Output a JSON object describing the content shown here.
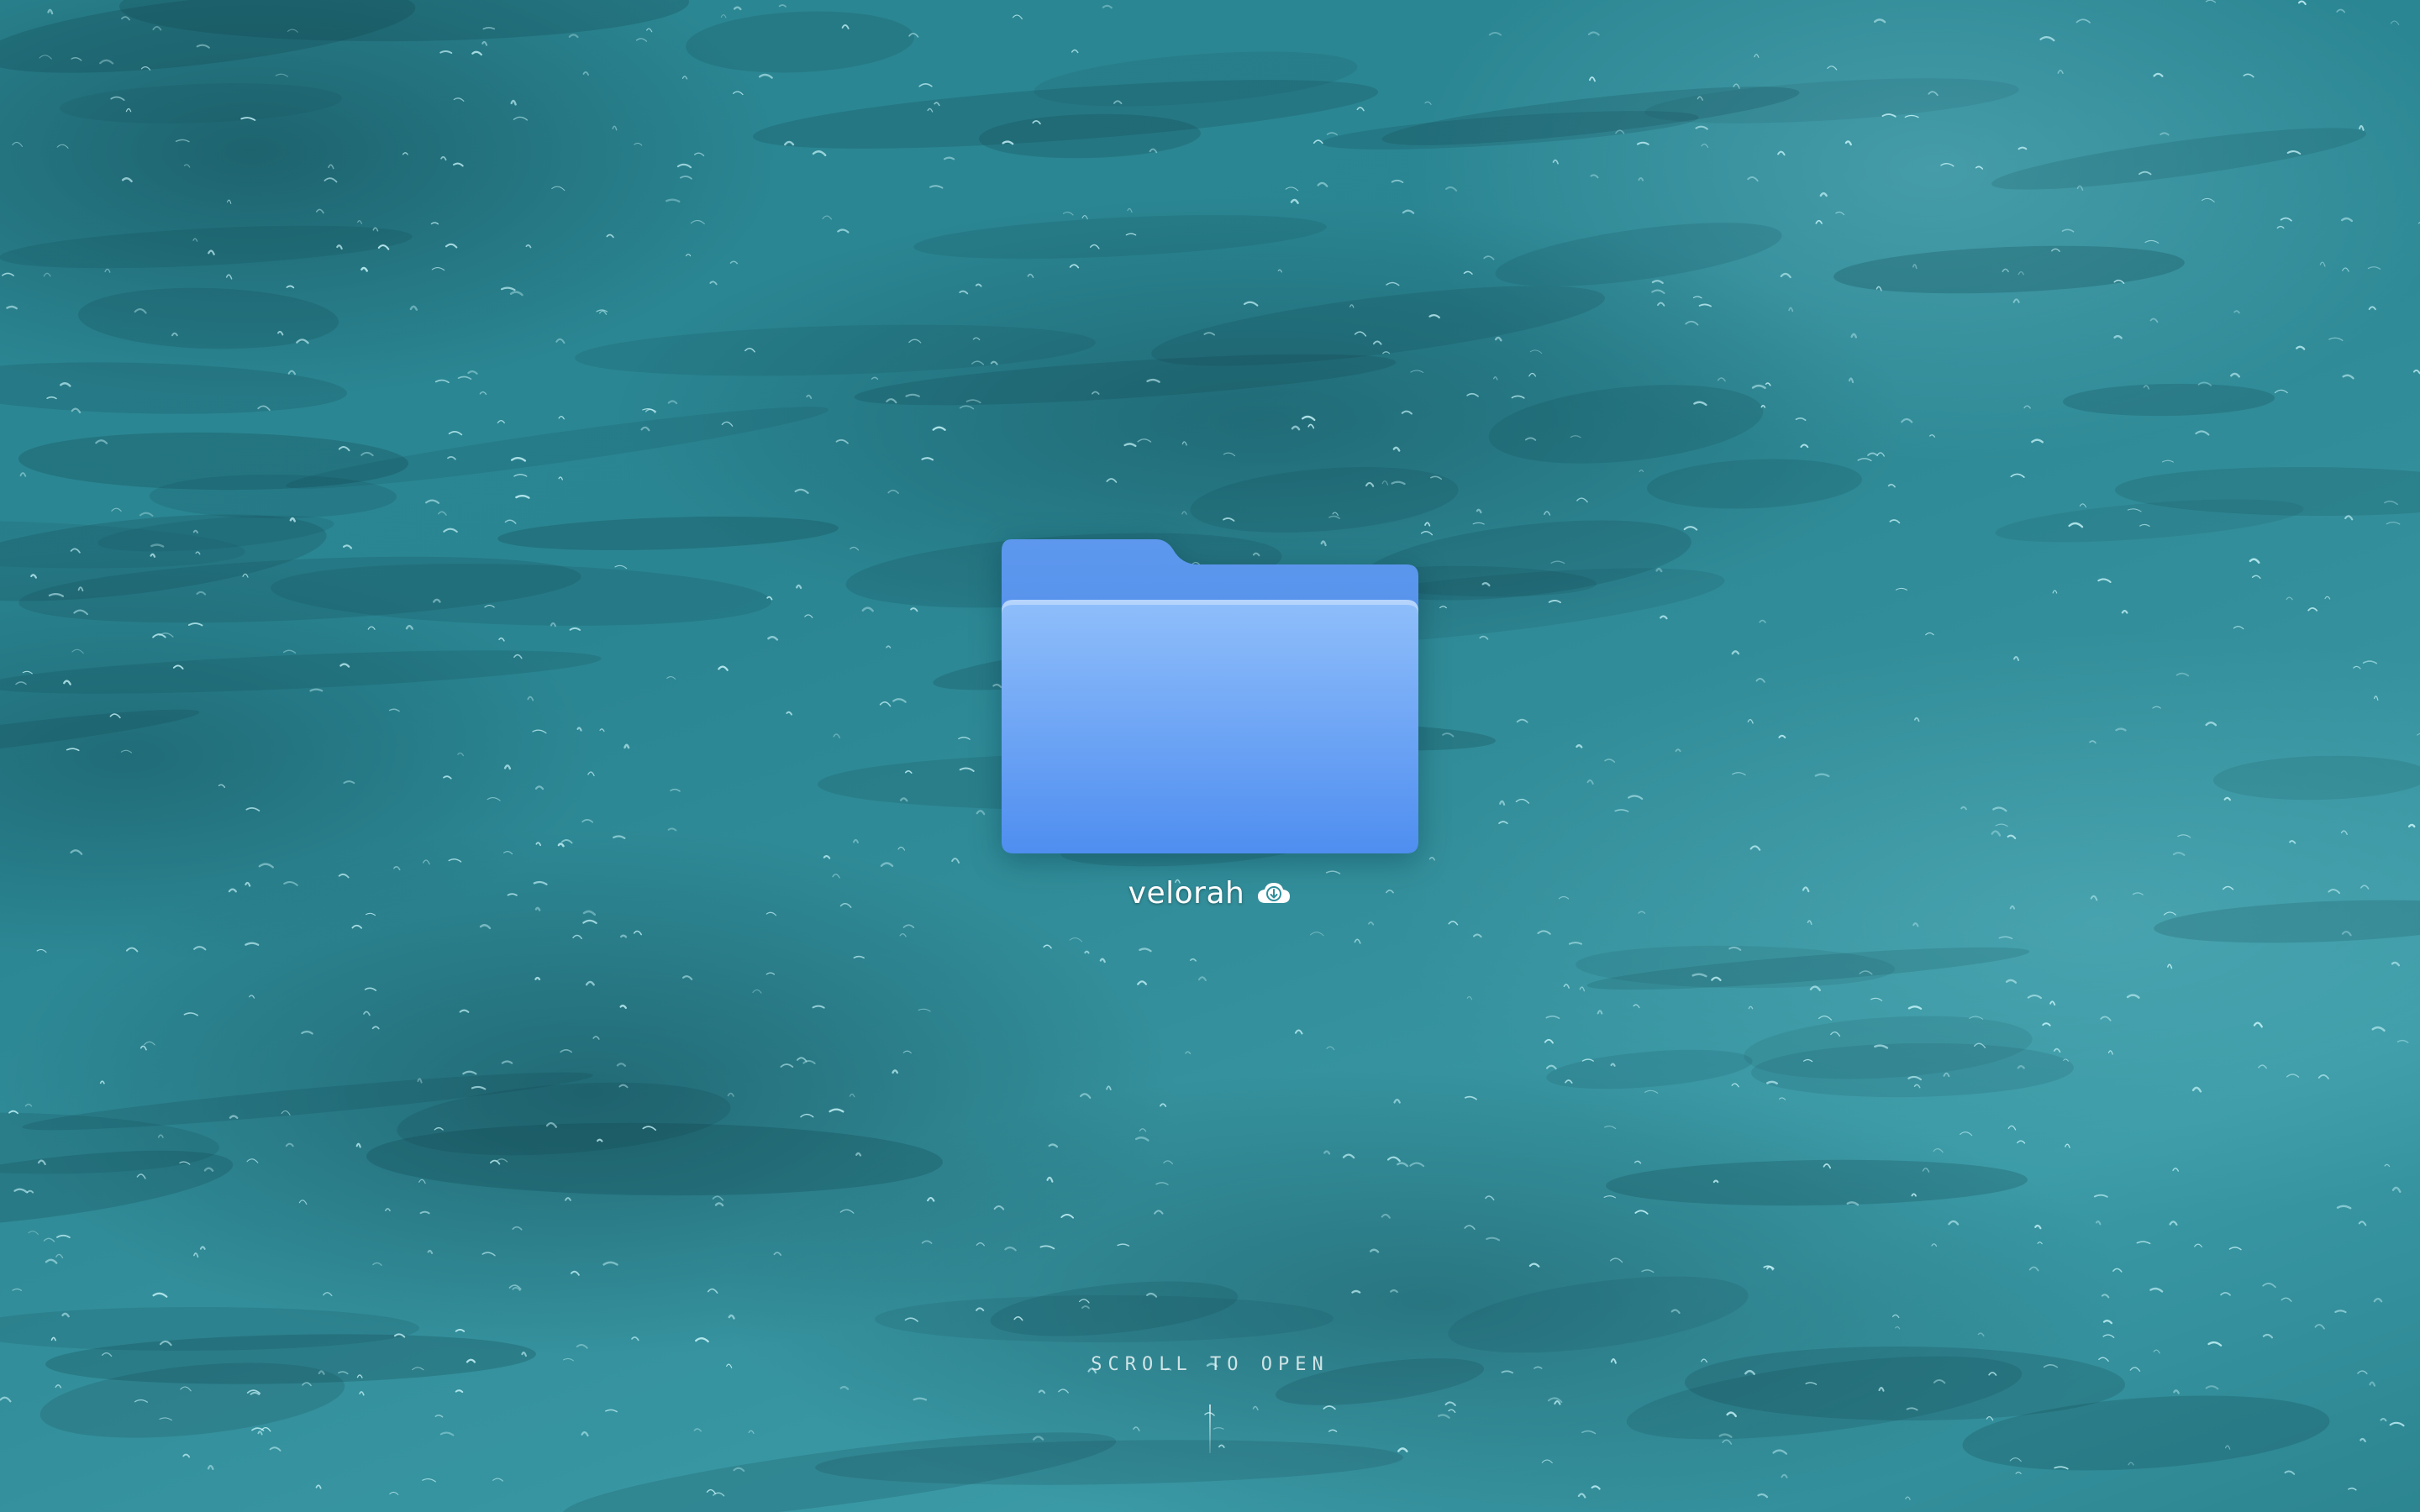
{
  "desktop": {
    "background": "ocean-water-wallpaper"
  },
  "folder": {
    "name": "velorah",
    "icon": "folder-icon",
    "status_icon": "cloud-download-icon",
    "color": "#5b9cf0"
  },
  "hint": {
    "text": "SCROLL TO OPEN",
    "indicator_icon": "scroll-line-indicator"
  }
}
